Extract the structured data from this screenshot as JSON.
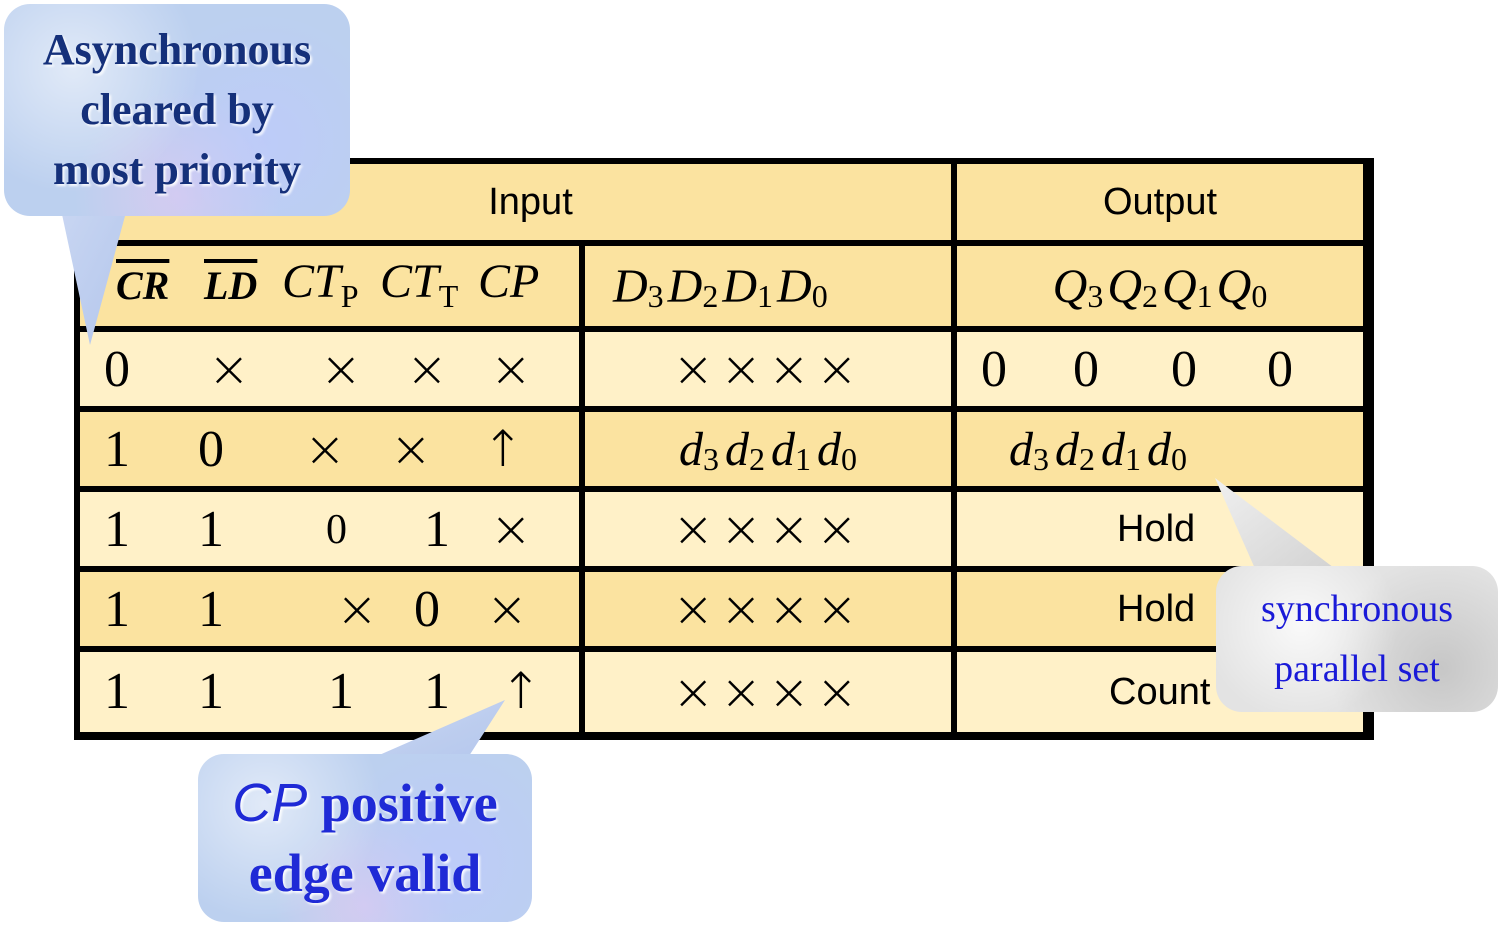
{
  "table": {
    "header_input": "Input",
    "header_output": "Output",
    "col_labels": {
      "cr": "CR",
      "ld": "LD",
      "ct": "CT",
      "p": "P",
      "t": "T",
      "cp": "CP",
      "d": "D",
      "q": "Q",
      "idx": [
        "3",
        "2",
        "1",
        "0"
      ]
    },
    "rows": [
      {
        "cr": "0",
        "ld": "×",
        "ctp": "×",
        "ctt": "×",
        "cp": "×",
        "d": "××××",
        "q": [
          "0",
          "0",
          "0",
          "0"
        ]
      },
      {
        "cr": "1",
        "ld": "0",
        "ctp": "×",
        "ctt": "×",
        "cp": "↑",
        "d_letter": "d",
        "q_letter": "d"
      },
      {
        "cr": "1",
        "ld": "1",
        "ctp": "0",
        "ctt": "1",
        "cp": "×",
        "d": "××××",
        "q_text": "Hold"
      },
      {
        "cr": "1",
        "ld": "1",
        "ctp": "×",
        "ctt": "0",
        "cp": "×",
        "d": "××××",
        "q_text": "Hold"
      },
      {
        "cr": "1",
        "ld": "1",
        "ctp": "1",
        "ctt": "1",
        "cp": "↑",
        "d": "××××",
        "q_text": "Count"
      }
    ]
  },
  "callouts": {
    "async": [
      "Asynchronous",
      "cleared by",
      "most priority"
    ],
    "edge_cp": "CP",
    "edge_rest": " positive",
    "edge_line2": "edge valid",
    "sync": [
      "synchronous",
      "parallel set"
    ]
  },
  "colors": {
    "header": "#fbe3a0",
    "row": "#fff1c8",
    "border": "#000000",
    "callout_blue": "#bcd0ef",
    "callout_grey": "#e3e3e3"
  }
}
